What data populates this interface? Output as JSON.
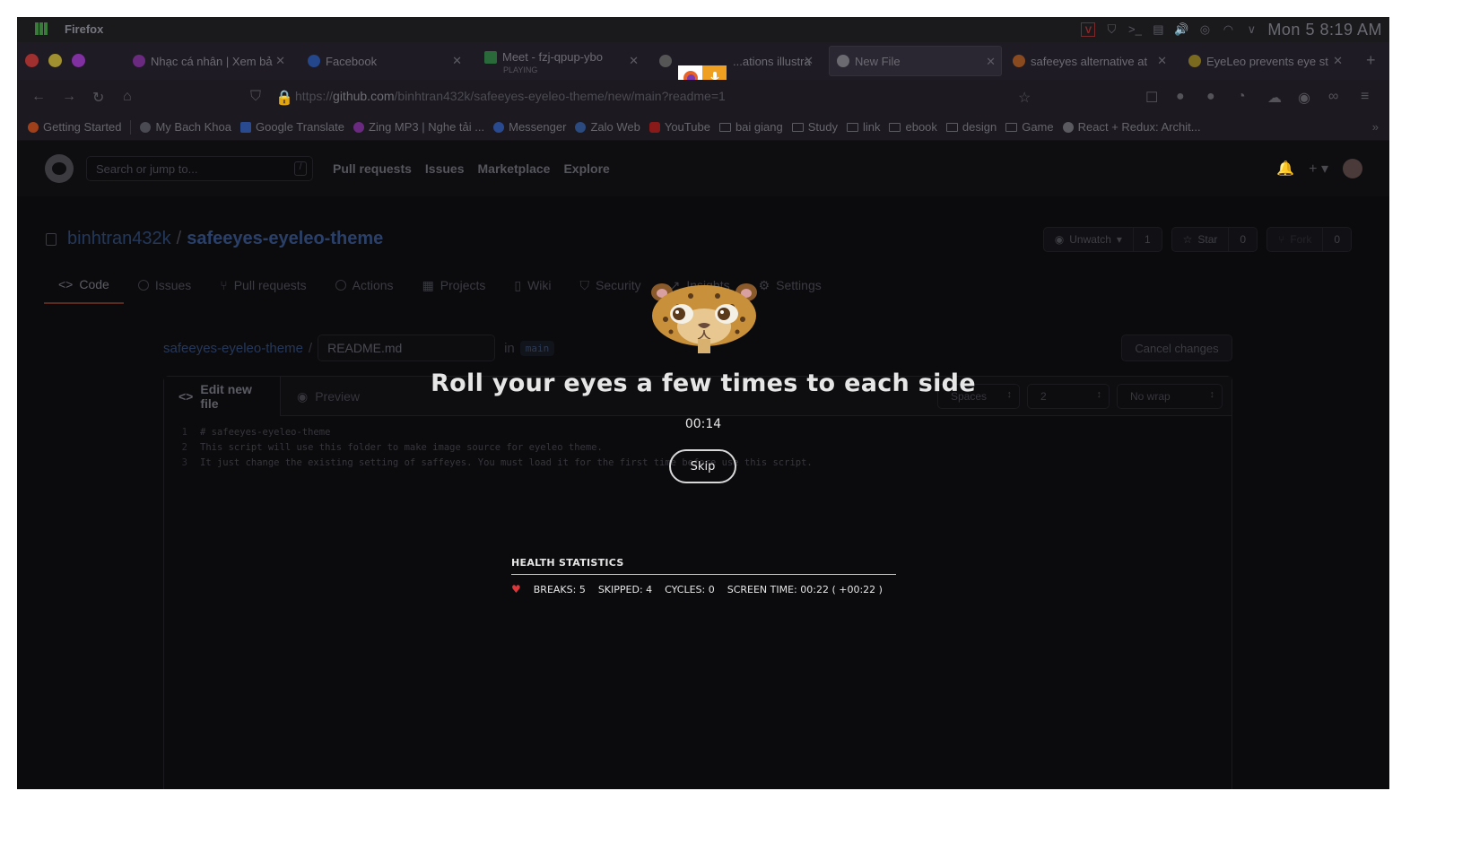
{
  "panel": {
    "app_name": "Firefox",
    "clock": "Mon 5  8:19 AM",
    "tray_icons": [
      "vivaldi-icon",
      "shield-icon",
      "terminal-icon",
      "clipboard-icon",
      "volume-icon",
      "microphone-icon",
      "wifi-icon",
      "chevron-down-icon"
    ]
  },
  "tabs": [
    {
      "label": "Nhạc cá nhân | Xem bả",
      "icon": "zing-icon",
      "color": "#8a3aa0"
    },
    {
      "label": "Facebook",
      "icon": "facebook-icon",
      "color": "#2a5ab0"
    },
    {
      "label": "Meet - fzj-qpup-ybo",
      "sub": "PLAYING",
      "icon": "meet-icon",
      "color": "#2a8a4a"
    },
    {
      "label": "...ations illustra",
      "icon": "github-icon",
      "color": "#6a6a6a"
    },
    {
      "label": "New File",
      "icon": "github-icon",
      "color": "#8a8a8a",
      "active": true
    },
    {
      "label": "safeeyes alternative at",
      "icon": "duckduckgo-icon",
      "color": "#b05a2a"
    },
    {
      "label": "EyeLeo prevents eye st",
      "icon": "eyeleo-icon",
      "color": "#a08a2a"
    }
  ],
  "navbar": {
    "url_prefix": "https://",
    "url_host": "github.com",
    "url_path": "/binhtran432k/safeeyes-eyeleo-theme/new/main?readme=1"
  },
  "bookmarks": [
    {
      "label": "Getting Started",
      "type": "site",
      "color": "#c0501a"
    },
    {
      "label": "My Bach Khoa",
      "type": "site",
      "color": "#5a5a62"
    },
    {
      "label": "Google Translate",
      "type": "site",
      "color": "#3a6ac0"
    },
    {
      "label": "Zing MP3 | Nghe tải ...",
      "type": "site",
      "color": "#8a3aa0"
    },
    {
      "label": "Messenger",
      "type": "site",
      "color": "#3a5ac0"
    },
    {
      "label": "Zalo Web",
      "type": "site",
      "color": "#3a6ab0"
    },
    {
      "label": "YouTube",
      "type": "site",
      "color": "#b02020"
    },
    {
      "label": "bai giang",
      "type": "folder"
    },
    {
      "label": "Study",
      "type": "folder"
    },
    {
      "label": "link",
      "type": "folder"
    },
    {
      "label": "ebook",
      "type": "folder"
    },
    {
      "label": "design",
      "type": "folder"
    },
    {
      "label": "Game",
      "type": "folder"
    },
    {
      "label": "React + Redux: Archit...",
      "type": "site",
      "color": "#6a6a70"
    }
  ],
  "github": {
    "search_placeholder": "Search or jump to...",
    "search_key": "/",
    "nav": [
      "Pull requests",
      "Issues",
      "Marketplace",
      "Explore"
    ],
    "owner": "binhtran432k",
    "repo": "safeeyes-eyeleo-theme",
    "watch": {
      "label": "Unwatch",
      "count": "1"
    },
    "star": {
      "label": "Star",
      "count": "0"
    },
    "fork": {
      "label": "Fork",
      "count": "0"
    },
    "repo_tabs": [
      "Code",
      "Issues",
      "Pull requests",
      "Actions",
      "Projects",
      "Wiki",
      "Security",
      "Insights",
      "Settings"
    ],
    "file_root": "safeeyes-eyeleo-theme",
    "file_name": "README.md",
    "in_label": "in",
    "branch": "main",
    "cancel_label": "Cancel changes",
    "editor_tabs": [
      "Edit new file",
      "Preview"
    ],
    "indent_mode": "Spaces",
    "indent_size": "2",
    "wrap_mode": "No wrap",
    "code_lines": [
      "# safeeyes-eyeleo-theme",
      "This script will use this folder to make image source for eyeleo theme.",
      "It just change the existing setting of saffeyes. You must load it for the first time before use this script."
    ]
  },
  "overlay": {
    "title": "Roll your eyes a few times to each side",
    "timer": "00:14",
    "skip_label": "Skip",
    "stats_title": "HEALTH STATISTICS",
    "breaks": "BREAKS: 5",
    "skipped": "SKIPPED: 4",
    "cycles": "CYCLES: 0",
    "screen_time": "SCREEN TIME: 00:22 ( +00:22 )"
  }
}
